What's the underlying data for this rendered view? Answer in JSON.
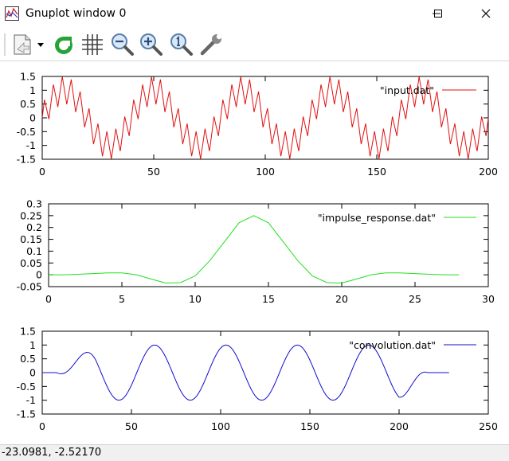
{
  "window": {
    "title": "Gnuplot window 0"
  },
  "window_controls": {
    "minimize": "minimize",
    "maximize": "maximize",
    "close": "close"
  },
  "toolbar": {
    "icons": [
      "copy-clipboard-icon",
      "dropdown-icon",
      "replot-icon",
      "grid-icon",
      "zoom-out-icon",
      "zoom-in-icon",
      "zoom-reset-icon",
      "options-wrench-icon"
    ]
  },
  "status": {
    "coordinates": "-23.0981, -2.52170"
  },
  "colors": {
    "input": "#e01010",
    "impulse": "#20e020",
    "convolution": "#1010d0"
  },
  "chart_data": [
    {
      "type": "line",
      "series": [
        {
          "name": "\"input.dat\"",
          "function": "sin(2*pi*x/40) + 0.5*sin(2*pi*x/4)",
          "x_range": [
            0,
            200
          ],
          "x_step": 1
        }
      ],
      "xlim": [
        0,
        200
      ],
      "ylim": [
        -1.5,
        1.5
      ],
      "xticks": [
        "0",
        "50",
        "100",
        "150",
        "200"
      ],
      "yticks": [
        "1.5",
        "1",
        "0.5",
        "0",
        "-0.5",
        "-1",
        "-1.5"
      ],
      "legend_position": "top-right"
    },
    {
      "type": "line",
      "series": [
        {
          "name": "\"impulse_response.dat\"",
          "x": [
            0,
            1,
            2,
            3,
            4,
            5,
            6,
            7,
            8,
            9,
            10,
            11,
            12,
            13,
            14,
            15,
            16,
            17,
            18,
            19,
            20,
            21,
            22,
            23,
            24,
            25,
            26,
            27,
            28
          ],
          "y": [
            0,
            0,
            0.002,
            0.005,
            0.008,
            0.008,
            0,
            -0.018,
            -0.035,
            -0.033,
            -0.005,
            0.06,
            0.14,
            0.22,
            0.25,
            0.22,
            0.14,
            0.06,
            -0.005,
            -0.033,
            -0.035,
            -0.018,
            0,
            0.008,
            0.008,
            0.005,
            0.002,
            0,
            0
          ]
        }
      ],
      "xlim": [
        0,
        30
      ],
      "ylim": [
        -0.05,
        0.3
      ],
      "xticks": [
        "0",
        "5",
        "10",
        "15",
        "20",
        "25",
        "30"
      ],
      "yticks": [
        "0.3",
        "0.25",
        "0.2",
        "0.15",
        "0.1",
        "0.05",
        "0",
        "-0.05"
      ],
      "legend_position": "top-right"
    },
    {
      "type": "line",
      "series": [
        {
          "name": "\"convolution.dat\"",
          "function": "sin(2*pi*(x-13)/40) with ramps at 0-30 and 200-228, zero elsewhere",
          "x_range": [
            0,
            228
          ],
          "x_step": 1
        }
      ],
      "xlim": [
        0,
        250
      ],
      "ylim": [
        -1.5,
        1.5
      ],
      "xticks": [
        "0",
        "50",
        "100",
        "150",
        "200",
        "250"
      ],
      "yticks": [
        "1.5",
        "1",
        "0.5",
        "0",
        "-0.5",
        "-1",
        "-1.5"
      ],
      "legend_position": "top-right"
    }
  ]
}
